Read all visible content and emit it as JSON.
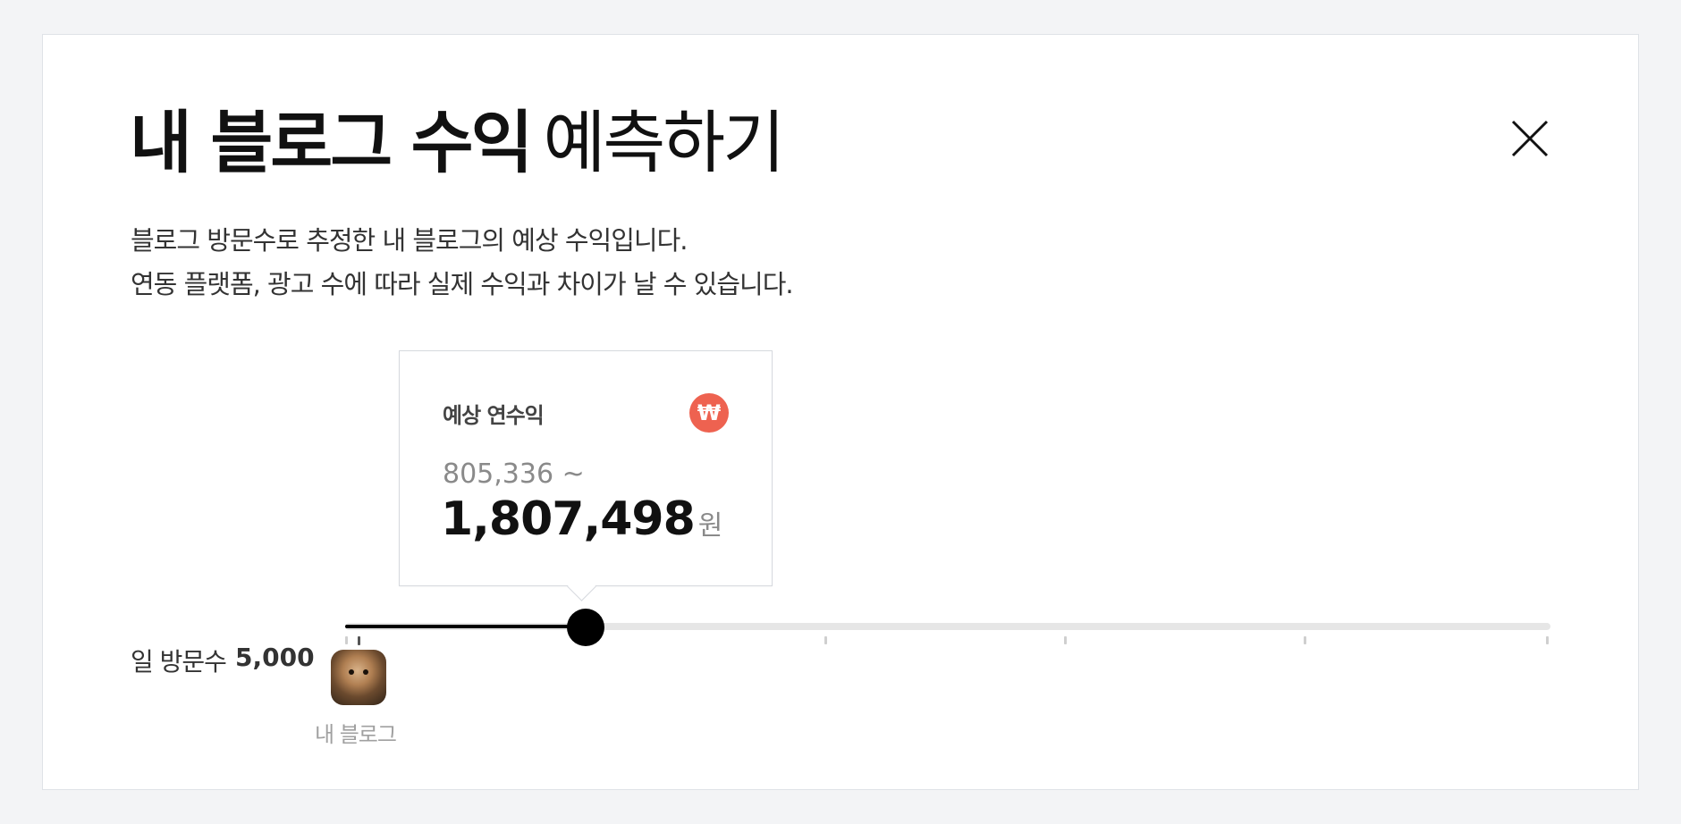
{
  "modal": {
    "title_bold": "내 블로그 수익",
    "title_light": "예측하기",
    "close_icon": "close-icon",
    "description_line1": "블로그 방문수로 추정한 내 블로그의 예상 수익입니다.",
    "description_line2": "연동 플랫폼, 광고 수에 따라 실제 수익과 차이가 날 수 있습니다."
  },
  "tooltip": {
    "label": "예상 연수익",
    "icon": "won-icon",
    "icon_glyph": "₩",
    "icon_color": "#ee6250",
    "min": "805,336 ~",
    "max": "1,807,498",
    "unit": "원"
  },
  "slider": {
    "label": "일 방문수",
    "value": "5,000",
    "fill_fraction": 0.2,
    "active_color": "#000000",
    "track_color": "#e6e6e6"
  },
  "my_blog": {
    "label": "내 블로그",
    "avatar_icon": "blog-avatar"
  }
}
